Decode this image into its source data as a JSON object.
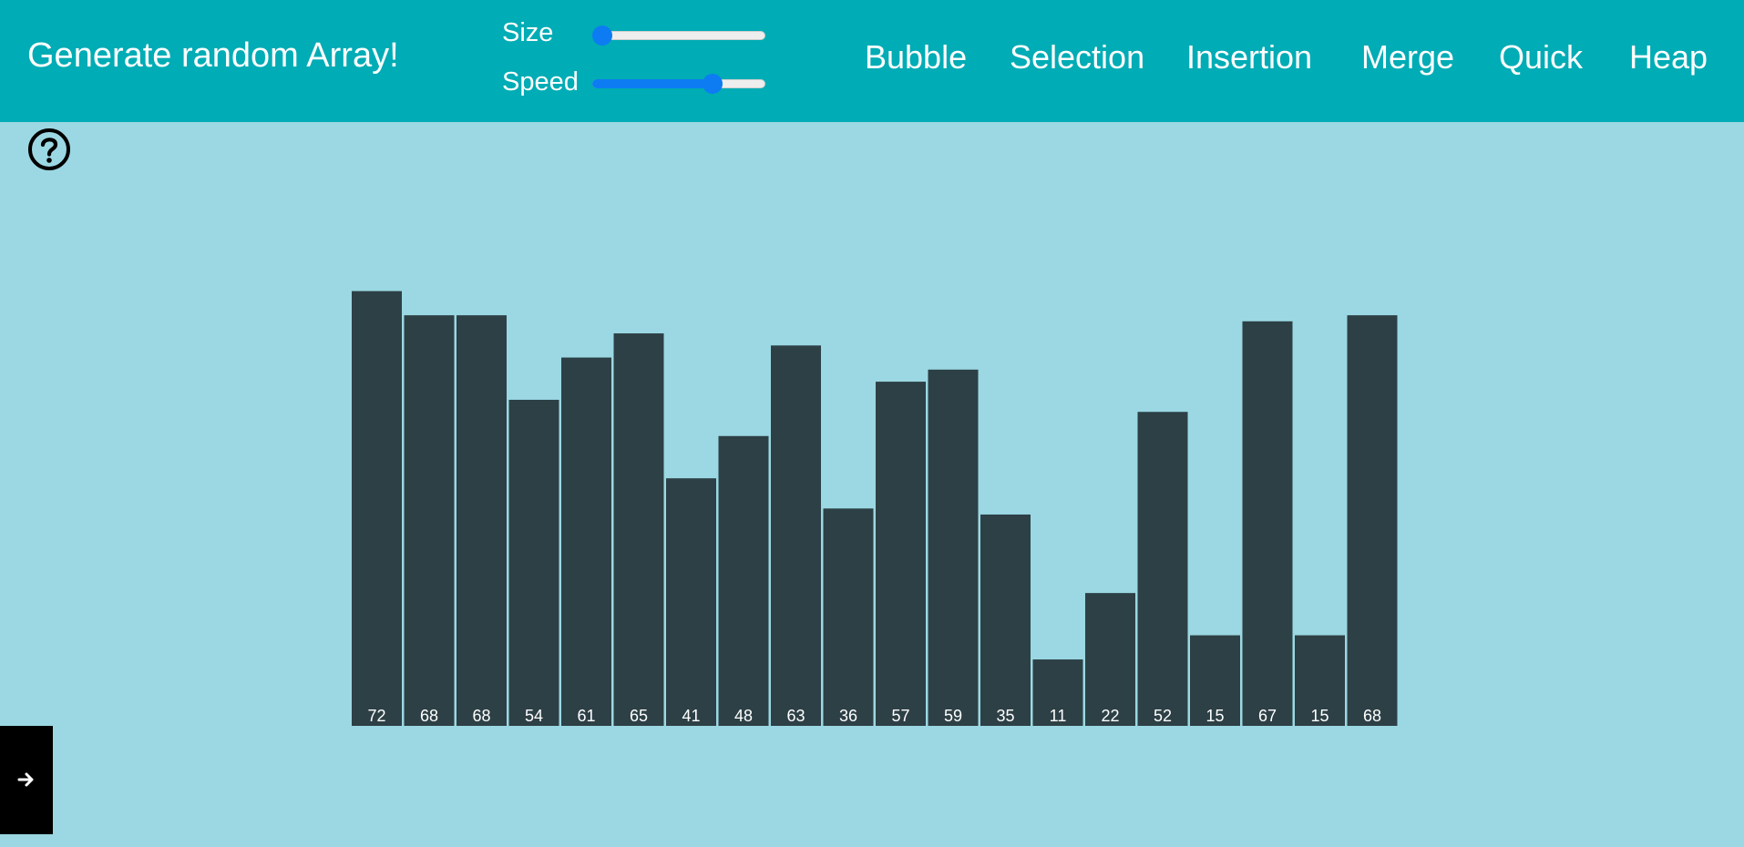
{
  "header": {
    "title": "Generate random Array!",
    "size_label": "Size",
    "speed_label": "Speed",
    "size_value": 0,
    "speed_value": 0.72,
    "algorithms": [
      "Bubble",
      "Selection",
      "Insertion",
      "Merge",
      "Quick",
      "Heap"
    ]
  },
  "icons": {
    "help": "help-circle-icon",
    "next": "arrow-right-icon"
  },
  "colors": {
    "navbar": "#00acb5",
    "background": "#9bd8e3",
    "bar": "#2d4046",
    "slider_accent": "#0d7cf2"
  },
  "chart_data": {
    "type": "bar",
    "values": [
      72,
      68,
      68,
      54,
      61,
      65,
      41,
      48,
      63,
      36,
      57,
      59,
      35,
      11,
      22,
      52,
      15,
      67,
      15,
      68
    ],
    "labels": [
      "72",
      "68",
      "68",
      "54",
      "61",
      "65",
      "41",
      "48",
      "63",
      "36",
      "57",
      "59",
      "35",
      "11",
      "22",
      "52",
      "15",
      "67",
      "15",
      "68"
    ]
  }
}
